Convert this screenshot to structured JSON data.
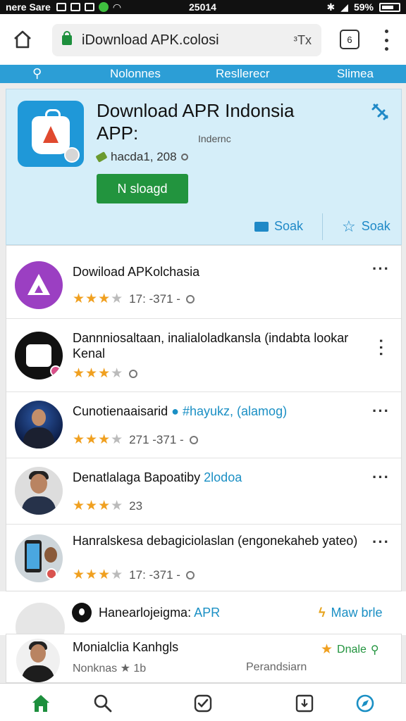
{
  "status_bar": {
    "carrier": "nere Sare",
    "time": "25014",
    "battery": "59%"
  },
  "browser": {
    "url": "iDownload APK.colosi",
    "tx_label": "ᵌTx",
    "tab_count": "6"
  },
  "nav_strip": {
    "items": [
      "Nolonnes",
      "Resllerecr",
      "Slimea"
    ]
  },
  "hero": {
    "title": "Download APR Indonsia APP:",
    "subtitle": "Indernc",
    "meta": "hacda1, 208",
    "download_label": "N sloagd",
    "action1": "Soak",
    "action2": "Soak",
    "accent": "#1f98d8"
  },
  "list": [
    {
      "title": "Dowiload APKolchasia",
      "rating_text": "17: -371 -",
      "stars": 3.5
    },
    {
      "title": "Dannniosaltaan, inalialoladkansla (indabta lookar Kenal",
      "rating_text": "",
      "stars": 3
    },
    {
      "title": "Cunotienaaisarid",
      "title_blue": "#hayukz, (alamog)",
      "rating_text": "271 -371 -",
      "stars": 3
    },
    {
      "title": "Denatlalaga Bapoatiby",
      "title_blue": "2lodoa",
      "rating_text": "23",
      "stars": 3.5
    },
    {
      "title": "Hanralskesa debagiciolaslan (engonekaheb yateo)",
      "rating_text": "17: -371 -",
      "stars": 3.5
    }
  ],
  "lower": {
    "title": "Hanearlojeigma:",
    "title_blue": "APR",
    "right_label": "Maw brle"
  },
  "bottom_card": {
    "name": "Monialclia Kanhgls",
    "sub": "Nonknas ★ 1b",
    "sub2": "Perandsiarn",
    "right_label": "Dnale"
  }
}
